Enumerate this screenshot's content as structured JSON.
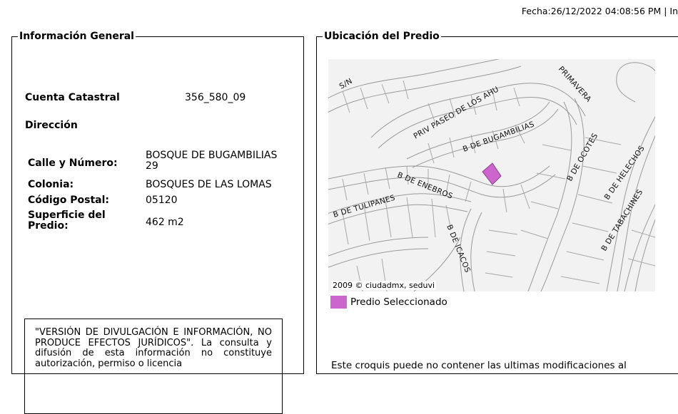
{
  "header": {
    "fecha": "Fecha:26/12/2022 04:08:56 PM | In"
  },
  "general": {
    "legend": "Información General",
    "cuenta_label": "Cuenta Catastral",
    "cuenta_value": "356_580_09",
    "direccion_label": "Dirección",
    "calle_label": "Calle y Número:",
    "calle_value_line1": "BOSQUE DE BUGAMBILIAS",
    "calle_value_line2": "29",
    "colonia_label": "Colonia:",
    "colonia_value": "BOSQUES DE LAS LOMAS",
    "cp_label": "Código Postal:",
    "cp_value": "05120",
    "superficie_label_line1": "Superficie del",
    "superficie_label_line2": "Predio:",
    "superficie_value": "462 m2",
    "disclaimer": "\"VERSIÓN DE DIVULGACIÓN E INFORMACIÓN, NO PRODUCE EFECTOS JURÍDICOS\". La consulta y difusión de esta información no constituye autorización, permiso o licencia"
  },
  "ubicacion": {
    "legend": "Ubicación del Predio",
    "map_copyright": "2009 © ciudadmx, seduvi",
    "legend_label": "Predio Seleccionado",
    "legend_color": "#cc66cc",
    "note": "Este croquis puede no contener las ultimas modificaciones al",
    "streets": {
      "sn": "S/N",
      "paseo": "PRIV PASEO DE LOS AHU",
      "primavera": "PRIMAVERA",
      "bugambilias": "B DE BUGAMBILIAS",
      "ocotes": "B DE OCOTES",
      "helechos": "B DE HELECHOS",
      "enebros": "B DE ENEBROS",
      "tulipanes": "B DE TULIPANES",
      "tabachines": "B DE TABACHINES",
      "cacos": "B DE ICACOS"
    }
  }
}
